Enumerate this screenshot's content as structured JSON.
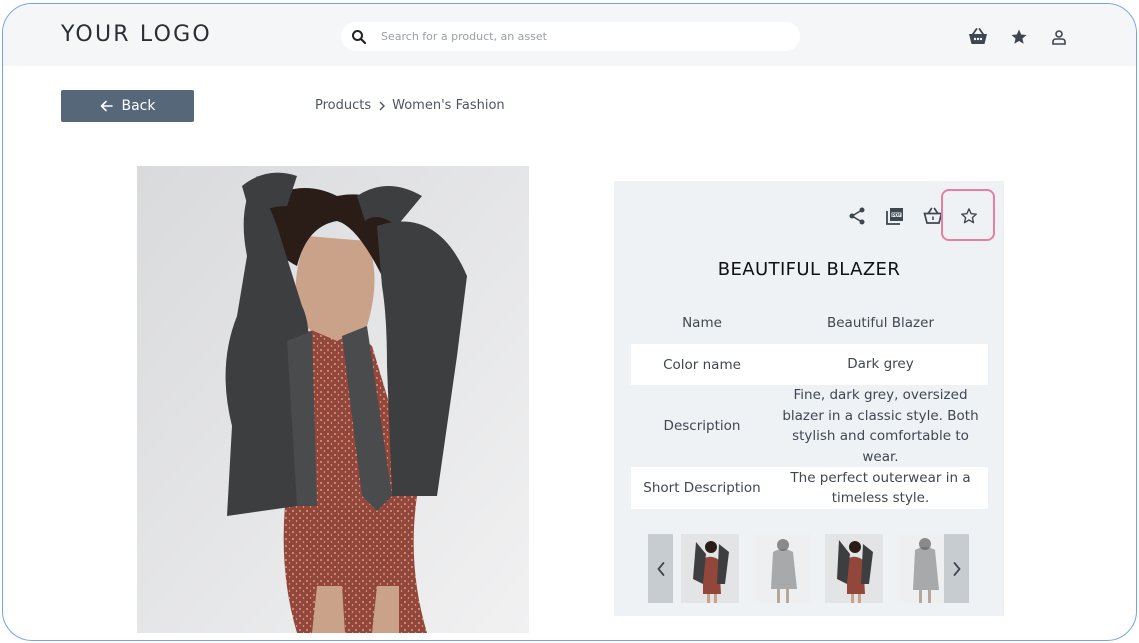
{
  "header": {
    "logo": "YOUR LOGO",
    "search_placeholder": "Search for a product, an asset",
    "icons": [
      "search-icon",
      "basket-icon",
      "star-icon",
      "user-icon"
    ]
  },
  "nav": {
    "back_label": "Back",
    "breadcrumb": [
      "Products",
      "Women's Fashion"
    ]
  },
  "product": {
    "title": "BEAUTIFUL BLAZER",
    "actions": [
      "share-icon",
      "pdf-icon",
      "basket-icon",
      "star-outline-icon"
    ],
    "specs": [
      {
        "key": "Name",
        "value": "Beautiful Blazer"
      },
      {
        "key": "Color name",
        "value": "Dark grey"
      },
      {
        "key": "Description",
        "value": "Fine, dark grey, oversized blazer in a classic style. Both stylish and comfortable to wear."
      },
      {
        "key": "Short Description",
        "value": "The perfect outerwear in a timeless style."
      }
    ]
  },
  "colors": {
    "back_button": "#556779",
    "highlight": "#e67fa0",
    "panel_bg": "#eef2f5",
    "blazer": "#3d3e40",
    "dress": "#9a4a3a"
  }
}
